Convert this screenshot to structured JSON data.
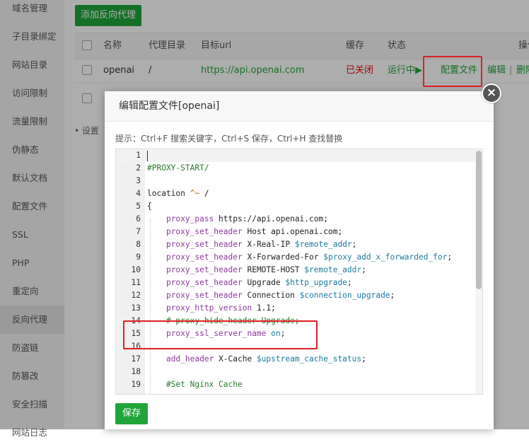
{
  "sidebar": {
    "items": [
      {
        "label": "域名管理"
      },
      {
        "label": "子目录绑定"
      },
      {
        "label": "网站目录"
      },
      {
        "label": "访问限制"
      },
      {
        "label": "流量限制"
      },
      {
        "label": "伪静态"
      },
      {
        "label": "默认文档"
      },
      {
        "label": "配置文件"
      },
      {
        "label": "SSL"
      },
      {
        "label": "PHP"
      },
      {
        "label": "重定向"
      },
      {
        "label": "反向代理"
      },
      {
        "label": "防盗链"
      },
      {
        "label": "防篡改"
      },
      {
        "label": "安全扫描"
      },
      {
        "label": "网站日志"
      }
    ],
    "active_index": 11
  },
  "toolbar": {
    "add_proxy_label": "添加反向代理"
  },
  "table": {
    "headers": {
      "name": "名称",
      "proxy_dir": "代理目录",
      "target_url": "目标url",
      "cache": "缓存",
      "status": "状态",
      "actions": "操作"
    },
    "row": {
      "name": "openai",
      "proxy_dir": "/",
      "target_url": "https://api.openai.com",
      "cache": "已关闭",
      "status": "运行中▶",
      "config": "配置文件",
      "edit": "编辑",
      "sep": "|",
      "delete": "删除"
    }
  },
  "page_note": "设置",
  "dialog": {
    "title": "编辑配置文件[openai]",
    "close_label": "×",
    "hint": "提示：Ctrl+F 搜索关键字，Ctrl+S 保存，Ctrl+H 查找替换",
    "save_label": "保存",
    "lines": [
      {
        "n": "1",
        "t": ""
      },
      {
        "n": "2",
        "t": "#PROXY-START/"
      },
      {
        "n": "3",
        "t": ""
      },
      {
        "n": "4",
        "t": "location ^~ /"
      },
      {
        "n": "5",
        "t": "{"
      },
      {
        "n": "6",
        "t": "    proxy_pass https://api.openai.com;"
      },
      {
        "n": "7",
        "t": "    proxy_set_header Host api.openai.com;"
      },
      {
        "n": "8",
        "t": "    proxy_set_header X-Real-IP $remote_addr;"
      },
      {
        "n": "9",
        "t": "    proxy_set_header X-Forwarded-For $proxy_add_x_forwarded_for;"
      },
      {
        "n": "10",
        "t": "    proxy_set_header REMOTE-HOST $remote_addr;"
      },
      {
        "n": "11",
        "t": "    proxy_set_header Upgrade $http_upgrade;"
      },
      {
        "n": "12",
        "t": "    proxy_set_header Connection $connection_upgrade;"
      },
      {
        "n": "13",
        "t": "    proxy_http_version 1.1;"
      },
      {
        "n": "14",
        "t": "    # proxy_hide_header Upgrade;"
      },
      {
        "n": "15",
        "t": "    proxy_ssl_server_name on;"
      },
      {
        "n": "16",
        "t": ""
      },
      {
        "n": "17",
        "t": "    add_header X-Cache $upstream_cache_status;"
      },
      {
        "n": "18",
        "t": ""
      },
      {
        "n": "19",
        "t": "    #Set Nginx Cache"
      }
    ]
  },
  "colors": {
    "accent": "#20a53a",
    "danger": "#ef0808",
    "highlight_box": "#e02020"
  }
}
